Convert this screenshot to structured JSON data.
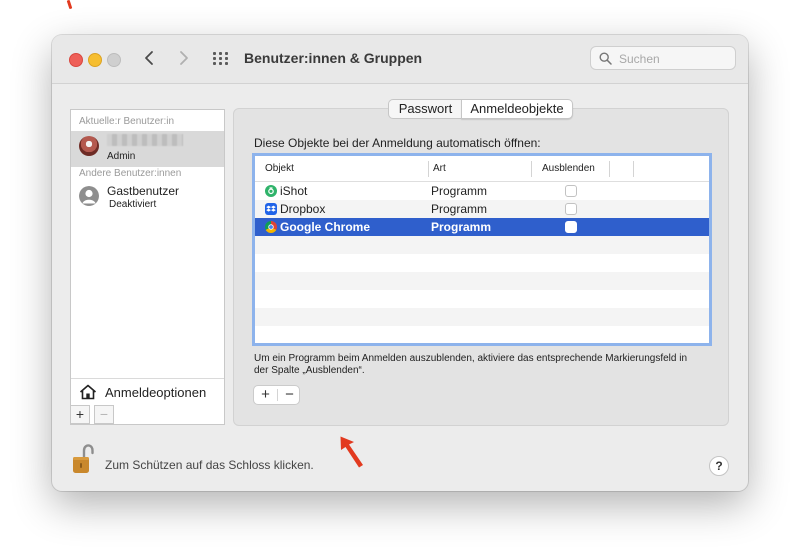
{
  "window": {
    "title": "Benutzer:innen & Gruppen",
    "search_placeholder": "Suchen"
  },
  "sidebar": {
    "current_section": "Aktuelle:r Benutzer:in",
    "current_user": {
      "name": "",
      "role": "Admin"
    },
    "other_section": "Andere Benutzer:innen",
    "other_users": [
      {
        "name": "Gastbenutzer",
        "status": "Deaktiviert"
      }
    ],
    "login_options_label": "Anmeldeoptionen",
    "add_symbol": "+",
    "remove_symbol": "−"
  },
  "tabs": {
    "items": [
      "Passwort",
      "Anmeldeobjekte"
    ],
    "selected": "Anmeldeobjekte"
  },
  "login_items": {
    "intro": "Diese Objekte bei der Anmeldung automatisch öffnen:",
    "columns": [
      "Objekt",
      "Art",
      "Ausblenden"
    ],
    "rows": [
      {
        "name": "iShot",
        "type": "Programm",
        "hidden": false,
        "icon": "ishot-icon"
      },
      {
        "name": "Dropbox",
        "type": "Programm",
        "hidden": false,
        "icon": "dropbox-icon"
      },
      {
        "name": "Google Chrome",
        "type": "Programm",
        "hidden": false,
        "icon": "chrome-icon",
        "selected": true
      }
    ],
    "hint": "Um ein Programm beim Anmelden auszublenden, aktiviere das entsprechende Markierungsfeld in der Spalte „Ausblenden“.",
    "add_symbol": "+",
    "remove_symbol": "−"
  },
  "footer": {
    "lock_text": "Zum Schützen auf das Schloss klicken.",
    "help_symbol": "?"
  },
  "colors": {
    "selection": "#2f5fcc",
    "focus_ring": "#8db3ec",
    "annotation_arrow": "#e23a1f"
  }
}
